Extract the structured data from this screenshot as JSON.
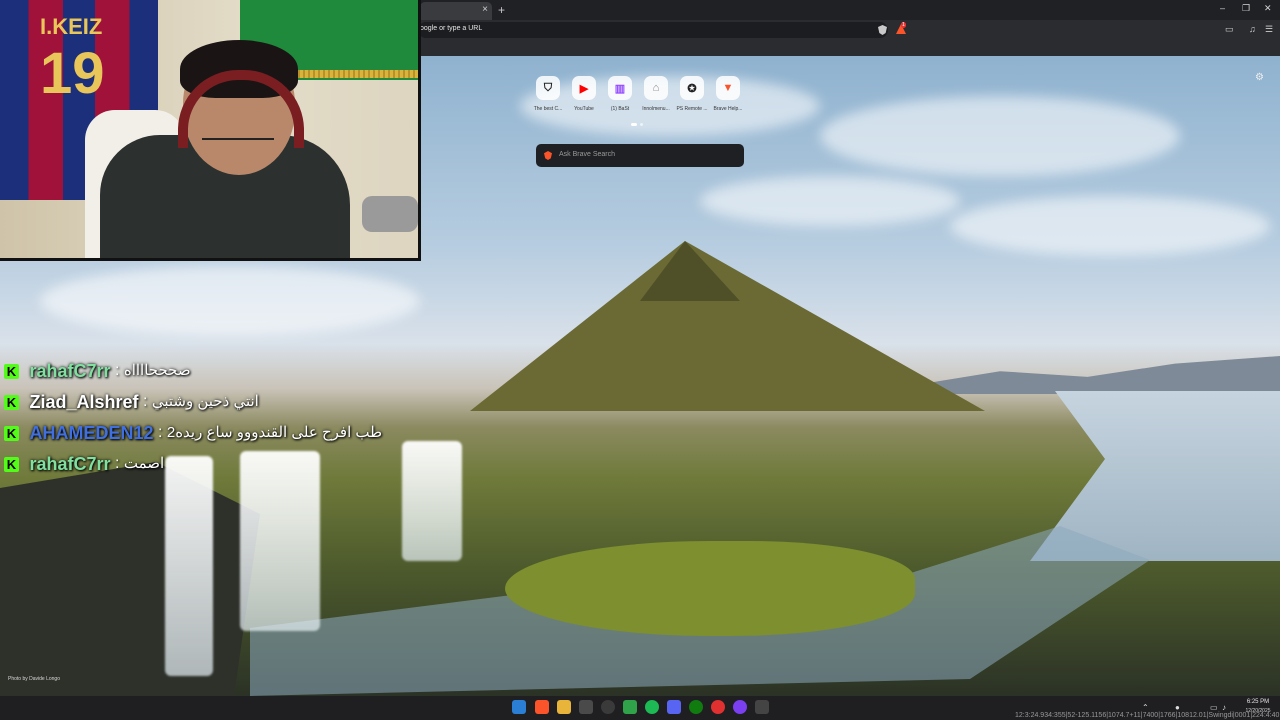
{
  "browser": {
    "tab_close": "×",
    "new_tab": "+",
    "window_controls": [
      "–",
      "❐",
      "✕"
    ],
    "url_text": "oogle or type a URL",
    "rewards_badge": "1"
  },
  "new_tab_page": {
    "tiles": [
      {
        "label": "The best C...",
        "icon": "gamepad-icon",
        "glyph": "⛉",
        "color": "#222222"
      },
      {
        "label": "YouTube",
        "icon": "youtube-icon",
        "glyph": "▶",
        "color": "#ff0000"
      },
      {
        "label": "(1) BaSt",
        "icon": "twitch-icon",
        "glyph": "▥",
        "color": "#9146ff"
      },
      {
        "label": "Innolmenu...",
        "icon": "home-icon",
        "glyph": "⌂",
        "color": "#888888"
      },
      {
        "label": "PS Remote ...",
        "icon": "playstation-icon",
        "glyph": "✪",
        "color": "#222222"
      },
      {
        "label": "Brave Help...",
        "icon": "brave-icon",
        "glyph": "▼",
        "color": "#fb542b"
      }
    ],
    "search_placeholder": "Ask Brave Search",
    "photo_credit": "Photo by Davide Longo"
  },
  "stream_overlay": {
    "jersey_name": "I.KEIZ",
    "jersey_number": "19"
  },
  "chat": [
    {
      "platform_badge": "K",
      "username": "rahafC7rr",
      "user_color": "#7fe0a0",
      "separator": ":",
      "message": "صحححااااه"
    },
    {
      "platform_badge": "K",
      "username": "Ziad_Alshref",
      "user_color": "#ffffff",
      "separator": ":",
      "message": "انتي ذحين وشتبي"
    },
    {
      "platform_badge": "K",
      "username": "AHAMEDEN12",
      "user_color": "#3f6fe0",
      "separator": ":",
      "message": "طب افرح على القندووو ساع ريده2"
    },
    {
      "platform_badge": "K",
      "username": "rahafC7rr",
      "user_color": "#7fe0a0",
      "separator": ":",
      "message": "اصمت"
    }
  ],
  "taskbar": {
    "time": "6:25 PM",
    "date": "12/20/2025",
    "overlay_text": "12:3:24.934:355|52-125.1156|1074.7+11|7400|1766|10812.01|Swingdi|0001|224:4:40"
  }
}
